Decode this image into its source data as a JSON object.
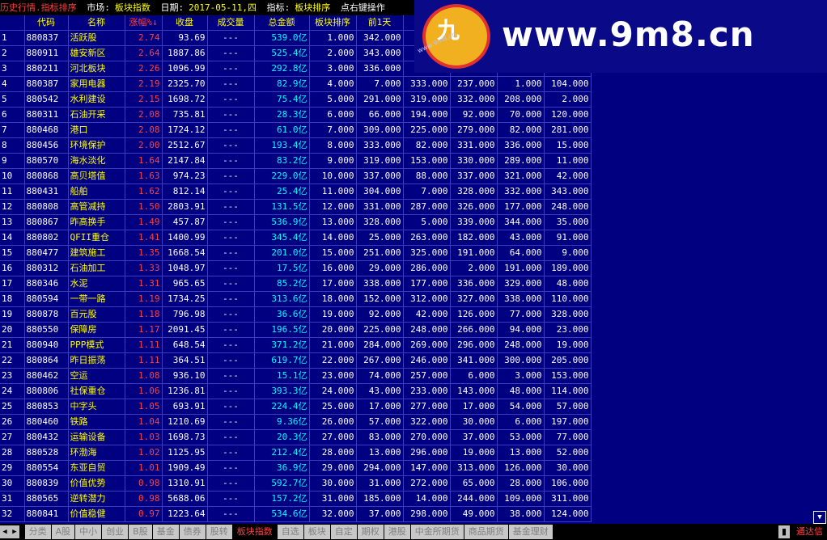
{
  "header": {
    "title": "历史行情.指标排序",
    "market_label": "市场:",
    "market_value": "板块指数",
    "date_label": "日期:",
    "date_value": "2017-05-11,四",
    "indicator_label": "指标:",
    "indicator_value": "板块排序",
    "hint": "点右键操作"
  },
  "columns": [
    "",
    "代码",
    "名称",
    "涨幅%↓",
    "收盘",
    "成交量",
    "总金额",
    "板块排序",
    "前1天",
    "",
    "",
    "",
    ""
  ],
  "rows": [
    [
      "1",
      "880837",
      "活跃股",
      "2.74",
      "93.69",
      "---",
      "539.0亿",
      "1.000",
      "342.000",
      "",
      "",
      "",
      ""
    ],
    [
      "2",
      "880911",
      "雄安新区",
      "2.64",
      "1887.86",
      "---",
      "525.4亿",
      "2.000",
      "343.000",
      "",
      "",
      "",
      ""
    ],
    [
      "3",
      "880211",
      "河北板块",
      "2.26",
      "1096.99",
      "---",
      "292.8亿",
      "3.000",
      "336.000",
      "",
      "",
      "",
      ""
    ],
    [
      "4",
      "880387",
      "家用电器",
      "2.19",
      "2325.70",
      "---",
      "82.9亿",
      "4.000",
      "7.000",
      "333.000",
      "237.000",
      "1.000",
      "104.000"
    ],
    [
      "5",
      "880542",
      "水利建设",
      "2.15",
      "1698.72",
      "---",
      "75.4亿",
      "5.000",
      "291.000",
      "319.000",
      "332.000",
      "208.000",
      "2.000"
    ],
    [
      "6",
      "880311",
      "石油开采",
      "2.08",
      "735.81",
      "---",
      "28.3亿",
      "6.000",
      "66.000",
      "194.000",
      "92.000",
      "70.000",
      "120.000"
    ],
    [
      "7",
      "880468",
      "港口",
      "2.08",
      "1724.12",
      "---",
      "61.0亿",
      "7.000",
      "309.000",
      "225.000",
      "279.000",
      "82.000",
      "281.000"
    ],
    [
      "8",
      "880456",
      "环境保护",
      "2.00",
      "2512.67",
      "---",
      "193.4亿",
      "8.000",
      "333.000",
      "82.000",
      "331.000",
      "336.000",
      "15.000"
    ],
    [
      "9",
      "880570",
      "海水淡化",
      "1.64",
      "2147.84",
      "---",
      "83.2亿",
      "9.000",
      "319.000",
      "153.000",
      "330.000",
      "289.000",
      "11.000"
    ],
    [
      "10",
      "880868",
      "高贝塔值",
      "1.63",
      "974.23",
      "---",
      "229.0亿",
      "10.000",
      "337.000",
      "88.000",
      "337.000",
      "321.000",
      "42.000"
    ],
    [
      "11",
      "880431",
      "船舶",
      "1.62",
      "812.14",
      "---",
      "25.4亿",
      "11.000",
      "304.000",
      "7.000",
      "328.000",
      "332.000",
      "343.000"
    ],
    [
      "12",
      "880808",
      "高管减持",
      "1.50",
      "2803.91",
      "---",
      "131.5亿",
      "12.000",
      "331.000",
      "287.000",
      "326.000",
      "177.000",
      "248.000"
    ],
    [
      "13",
      "880867",
      "昨高换手",
      "1.49",
      "457.87",
      "---",
      "536.9亿",
      "13.000",
      "328.000",
      "5.000",
      "339.000",
      "344.000",
      "35.000"
    ],
    [
      "14",
      "880802",
      "QFII重仓",
      "1.41",
      "1400.99",
      "---",
      "345.4亿",
      "14.000",
      "25.000",
      "263.000",
      "182.000",
      "43.000",
      "91.000"
    ],
    [
      "15",
      "880477",
      "建筑施工",
      "1.35",
      "1668.54",
      "---",
      "201.0亿",
      "15.000",
      "251.000",
      "325.000",
      "191.000",
      "64.000",
      "9.000"
    ],
    [
      "16",
      "880312",
      "石油加工",
      "1.33",
      "1048.97",
      "---",
      "17.5亿",
      "16.000",
      "29.000",
      "286.000",
      "2.000",
      "191.000",
      "189.000"
    ],
    [
      "17",
      "880346",
      "水泥",
      "1.31",
      "965.65",
      "---",
      "85.2亿",
      "17.000",
      "338.000",
      "177.000",
      "336.000",
      "329.000",
      "48.000"
    ],
    [
      "18",
      "880594",
      "一带一路",
      "1.19",
      "1734.25",
      "---",
      "313.6亿",
      "18.000",
      "152.000",
      "312.000",
      "327.000",
      "338.000",
      "110.000"
    ],
    [
      "19",
      "880878",
      "百元股",
      "1.18",
      "796.98",
      "---",
      "36.6亿",
      "19.000",
      "92.000",
      "42.000",
      "126.000",
      "77.000",
      "328.000"
    ],
    [
      "20",
      "880550",
      "保障房",
      "1.17",
      "2091.45",
      "---",
      "196.5亿",
      "20.000",
      "225.000",
      "248.000",
      "266.000",
      "94.000",
      "23.000"
    ],
    [
      "21",
      "880940",
      "PPP模式",
      "1.11",
      "648.54",
      "---",
      "371.2亿",
      "21.000",
      "284.000",
      "269.000",
      "296.000",
      "248.000",
      "19.000"
    ],
    [
      "22",
      "880864",
      "昨日振荡",
      "1.11",
      "364.51",
      "---",
      "619.7亿",
      "22.000",
      "267.000",
      "246.000",
      "341.000",
      "300.000",
      "205.000"
    ],
    [
      "23",
      "880462",
      "空运",
      "1.08",
      "936.10",
      "---",
      "15.1亿",
      "23.000",
      "74.000",
      "257.000",
      "6.000",
      "3.000",
      "153.000"
    ],
    [
      "24",
      "880806",
      "社保重仓",
      "1.06",
      "1236.81",
      "---",
      "393.3亿",
      "24.000",
      "43.000",
      "233.000",
      "143.000",
      "48.000",
      "114.000"
    ],
    [
      "25",
      "880853",
      "中字头",
      "1.05",
      "693.91",
      "---",
      "224.4亿",
      "25.000",
      "17.000",
      "277.000",
      "17.000",
      "54.000",
      "57.000"
    ],
    [
      "26",
      "880460",
      "铁路",
      "1.04",
      "1210.69",
      "---",
      "9.36亿",
      "26.000",
      "57.000",
      "322.000",
      "30.000",
      "6.000",
      "197.000"
    ],
    [
      "27",
      "880432",
      "运输设备",
      "1.03",
      "1698.73",
      "---",
      "20.3亿",
      "27.000",
      "83.000",
      "270.000",
      "37.000",
      "53.000",
      "77.000"
    ],
    [
      "28",
      "880528",
      "环渤海",
      "1.02",
      "1125.95",
      "---",
      "212.4亿",
      "28.000",
      "13.000",
      "296.000",
      "19.000",
      "13.000",
      "52.000"
    ],
    [
      "29",
      "880554",
      "东亚自贸",
      "1.01",
      "1909.49",
      "---",
      "36.9亿",
      "29.000",
      "294.000",
      "147.000",
      "313.000",
      "126.000",
      "30.000"
    ],
    [
      "30",
      "880839",
      "价值优势",
      "0.98",
      "1310.91",
      "---",
      "592.7亿",
      "30.000",
      "31.000",
      "272.000",
      "65.000",
      "28.000",
      "106.000"
    ],
    [
      "31",
      "880565",
      "逆转潜力",
      "0.98",
      "5688.06",
      "---",
      "157.2亿",
      "31.000",
      "185.000",
      "14.000",
      "244.000",
      "109.000",
      "311.000"
    ],
    [
      "32",
      "880841",
      "价值稳健",
      "0.97",
      "1223.64",
      "---",
      "534.6亿",
      "32.000",
      "37.000",
      "298.000",
      "49.000",
      "38.000",
      "124.000"
    ]
  ],
  "watermark": {
    "url": "www.9m8.cn",
    "emblem_text": "九",
    "small": "www.9m8.cn"
  },
  "bottom_tabs": [
    "分类",
    "A股",
    "中小",
    "创业",
    "B股",
    "基金",
    "债券",
    "股转",
    "板块指数",
    "自选",
    "板块",
    "自定",
    "期权",
    "港股",
    "中金所期货",
    "商品期货",
    "基金理财"
  ],
  "active_tab_index": 8,
  "bottom_right": {
    "scroll_down": "▼",
    "nav_label": "通达信"
  },
  "colors": {
    "background": "#000080",
    "header_text": "#ffff00",
    "change_up": "#ff4040",
    "amount": "#00ffff"
  }
}
